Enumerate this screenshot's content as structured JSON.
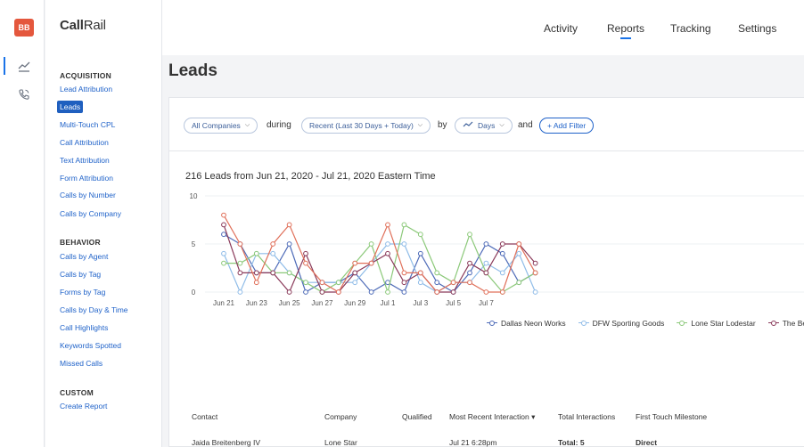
{
  "rail": {
    "avatar_initials": "BB",
    "icons": [
      "reports-chart-icon",
      "phone-tracking-icon"
    ]
  },
  "sidebar": {
    "logo_bold": "Call",
    "logo_rest": "Rail",
    "sections": [
      {
        "title": "ACQUISITION",
        "items": [
          "Lead Attribution",
          "Leads",
          "Multi-Touch CPL",
          "Call Attribution",
          "Text Attribution",
          "Form Attribution",
          "Calls by Number",
          "Calls by Company"
        ]
      },
      {
        "title": "BEHAVIOR",
        "items": [
          "Calls by Agent",
          "Calls by Tag",
          "Forms by Tag",
          "Calls by Day & Time",
          "Call Highlights",
          "Keywords Spotted",
          "Missed Calls"
        ]
      },
      {
        "title": "CUSTOM",
        "items": [
          "Create Report"
        ]
      }
    ],
    "active_item": "Leads"
  },
  "topnav": {
    "items": [
      "Activity",
      "Reports",
      "Tracking",
      "Settings"
    ],
    "active": "Reports"
  },
  "page": {
    "title": "Leads"
  },
  "filters": {
    "company": "All Companies",
    "during_label": "during",
    "range": "Recent (Last 30 Days + Today)",
    "by_label": "by",
    "interval": "Days",
    "and_label": "and",
    "add_filter": "+ Add Filter"
  },
  "chart_data": {
    "type": "line",
    "title": "216 Leads from Jun 21, 2020 - Jul 21, 2020 Eastern Time",
    "x": [
      "Jun 21",
      "Jun 22",
      "Jun 23",
      "Jun 24",
      "Jun 25",
      "Jun 26",
      "Jun 27",
      "Jun 28",
      "Jun 29",
      "Jun 30",
      "Jul 1",
      "Jul 2",
      "Jul 3",
      "Jul 4",
      "Jul 5",
      "Jul 6",
      "Jul 7",
      "Jul 8",
      "Jul 9",
      "Jul 10"
    ],
    "x_tick_labels": [
      "Jun 21",
      "Jun 23",
      "Jun 25",
      "Jun 27",
      "Jun 29",
      "Jul 1",
      "Jul 3",
      "Jul 5",
      "Jul 7"
    ],
    "y_ticks": [
      0,
      5,
      10
    ],
    "ylim": [
      0,
      10
    ],
    "series": [
      {
        "name": "Dallas Neon Works",
        "color": "#4e6bb8",
        "values": [
          6,
          5,
          2,
          2,
          5,
          0,
          1,
          1,
          2,
          0,
          1,
          0,
          4,
          1,
          0,
          2,
          5,
          4,
          1,
          2
        ]
      },
      {
        "name": "DFW Sporting Goods",
        "color": "#8fbce8",
        "values": [
          4,
          0,
          4,
          4,
          2,
          1,
          1,
          1,
          1,
          3,
          5,
          5,
          1,
          0,
          1,
          1,
          3,
          2,
          4,
          0
        ]
      },
      {
        "name": "Lone Star Lodestar",
        "color": "#8cc97a",
        "values": [
          3,
          3,
          4,
          2,
          2,
          1,
          0,
          1,
          3,
          5,
          0,
          7,
          6,
          2,
          1,
          6,
          2,
          0,
          1,
          2
        ]
      },
      {
        "name": "The Bel",
        "color": "#8a3a5a",
        "values": [
          7,
          2,
          2,
          2,
          0,
          4,
          0,
          0,
          2,
          3,
          4,
          1,
          2,
          0,
          0,
          3,
          2,
          5,
          5,
          3
        ]
      },
      {
        "name": "",
        "color": "#e0705a",
        "values": [
          8,
          5,
          1,
          5,
          7,
          3,
          1,
          0,
          3,
          3,
          7,
          2,
          2,
          0,
          1,
          1,
          0,
          0,
          5,
          2
        ]
      }
    ],
    "legend_position": "bottom",
    "grid": true
  },
  "table": {
    "headers": [
      "Contact",
      "Company",
      "Qualified",
      "Most Recent Interaction ▾",
      "Total Interactions",
      "First Touch Milestone"
    ],
    "rows": [
      [
        "Jaida Breitenberg IV",
        "Lone Star",
        "",
        "Jul 21 6:28pm",
        "Total: 5",
        "Direct"
      ]
    ]
  }
}
